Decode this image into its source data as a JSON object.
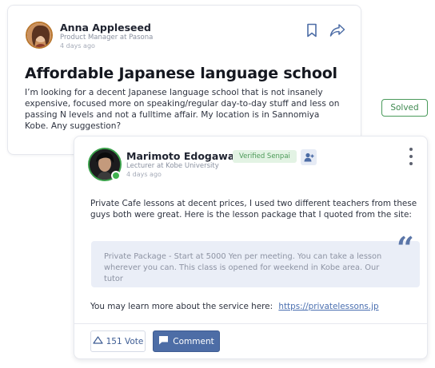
{
  "question": {
    "author_name": "Anna Appleseed",
    "author_role": "Product Manager at Pasona",
    "posted": "4 days ago",
    "title": "Affordable Japanese language school",
    "body": "I’m looking for a decent Japanese language school that is not insanely expensive, focused more on speaking/regular day-to-day stuff and less on passing N levels and not a fulltime affair. My location is in Sannomiya Kobe. Any suggestion?",
    "actions": {
      "bookmark_icon": "bookmark-icon",
      "share_icon": "share-icon"
    }
  },
  "status": {
    "label": "Solved",
    "color": "#3f8a50"
  },
  "answer": {
    "author_name": "Marimoto Edogawa",
    "author_role": "Lecturer at Kobe University",
    "posted": "4 days ago",
    "verified_label": "Verified Senpai",
    "online": true,
    "body": "Private Cafe lessons at decent prices, I used two different teachers from these guys both were great.  Here is the lesson package that I quoted from the site:",
    "quote": "Private Package - Start at 5000 Yen per meeting. You can take a lesson wherever you can. This class is opened for weekend in Kobe area. Our tutor",
    "learn_more_text": "You may learn more about the service here:",
    "link_text": "https://privatelessons.jp",
    "vote_count_label": "151 Vote",
    "comment_label": "Comment"
  },
  "colors": {
    "accent": "#4d6da6",
    "verified_bg": "#e3f3e4",
    "online": "#3fb34f"
  }
}
